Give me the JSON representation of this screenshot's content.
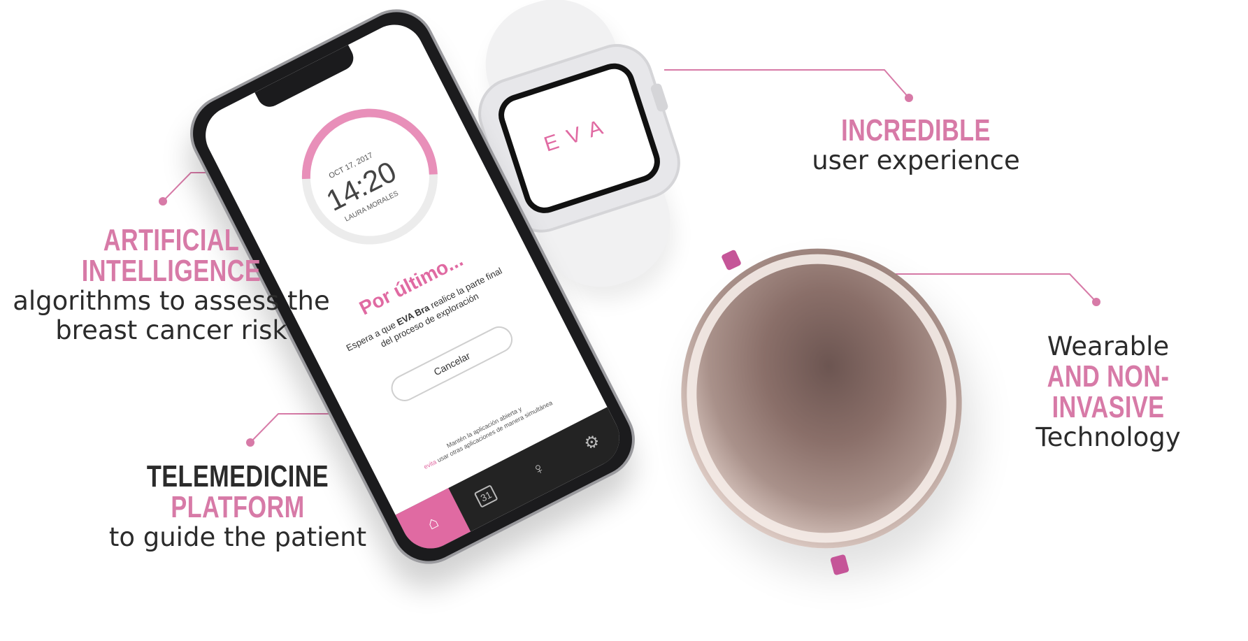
{
  "callouts": {
    "ai": {
      "heading": "ARTIFICIAL INTELLIGENCE",
      "sub_line1": "algorithms to assess the",
      "sub_line2": "breast cancer risk"
    },
    "telemedicine": {
      "heading_dark": "TELEMEDICINE",
      "heading_pink": "PLATFORM",
      "sub": "to guide the patient"
    },
    "ux": {
      "heading": "INCREDIBLE",
      "sub": "user experience"
    },
    "wearable": {
      "line1": "Wearable",
      "heading": "AND NON-INVASIVE",
      "line3": "Technology"
    }
  },
  "phone_screen": {
    "date": "OCT 17, 2017",
    "time": "14:20",
    "user": "LAURA MORALES",
    "title": "Por último...",
    "message_pre": "Espera a que",
    "message_bold": "EVA Bra",
    "message_post": "realice la parte final del proceso de exploración",
    "cancel_label": "Cancelar",
    "footer_line1": "Mantén la aplicación abierta y",
    "footer_evita": "evita",
    "footer_line2": "usar otras aplicaciones de manera simultánea",
    "tabs": [
      {
        "icon": "home-icon",
        "glyph": "⌂"
      },
      {
        "icon": "calendar-icon",
        "glyph": "31"
      },
      {
        "icon": "bra-icon",
        "glyph": "♀"
      },
      {
        "icon": "gear-icon",
        "glyph": "⚙"
      }
    ]
  },
  "watch_face": {
    "logo": "EVA"
  },
  "colors": {
    "accent": "#d77aa7",
    "dark_text": "#2b2b2b",
    "line": "#d77aa7"
  }
}
